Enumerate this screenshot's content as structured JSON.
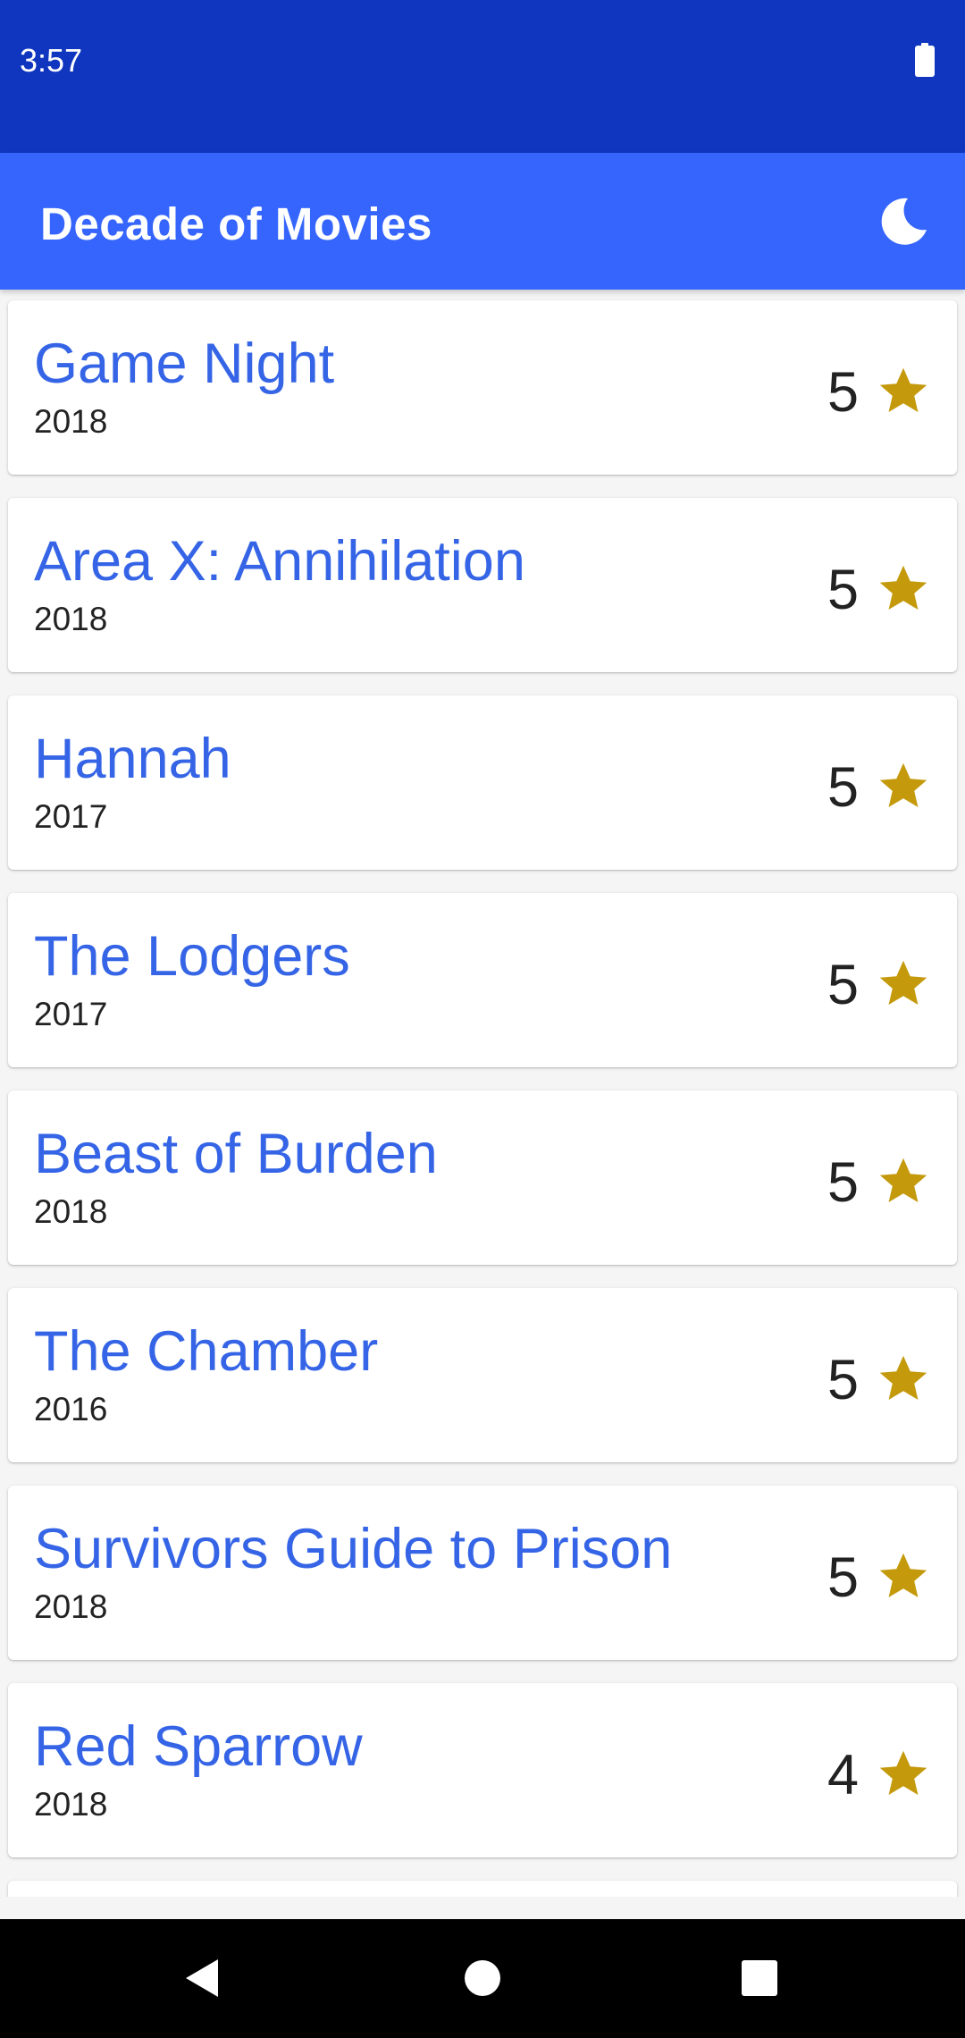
{
  "status_bar": {
    "time": "3:57"
  },
  "app_bar": {
    "title": "Decade of Movies",
    "night_mode_icon": "moon-icon"
  },
  "movies": [
    {
      "title": "Game Night",
      "year": "2018",
      "rating": "5"
    },
    {
      "title": "Area X: Annihilation",
      "year": "2018",
      "rating": "5"
    },
    {
      "title": "Hannah",
      "year": "2017",
      "rating": "5"
    },
    {
      "title": "The Lodgers",
      "year": "2017",
      "rating": "5"
    },
    {
      "title": "Beast of Burden",
      "year": "2018",
      "rating": "5"
    },
    {
      "title": "The Chamber",
      "year": "2016",
      "rating": "5"
    },
    {
      "title": "Survivors Guide to Prison",
      "year": "2018",
      "rating": "5"
    },
    {
      "title": "Red Sparrow",
      "year": "2018",
      "rating": "4"
    }
  ],
  "colors": {
    "status_bar": "#1036bf",
    "app_bar": "#3565fd",
    "title_text": "#3565e6",
    "star": "#c49a0c",
    "nav_bar": "#000000"
  },
  "icons": {
    "rating": "star-icon",
    "battery": "battery-icon",
    "nav_back": "back-triangle-icon",
    "nav_home": "home-circle-icon",
    "nav_recents": "recents-square-icon"
  }
}
